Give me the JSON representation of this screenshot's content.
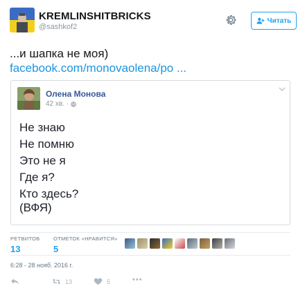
{
  "header": {
    "display_name": "KREMLINSHITBRICKS",
    "handle": "@sashkof2",
    "follow_label": "Читать"
  },
  "tweet": {
    "text": "...и шапка не моя)",
    "link": "facebook.com/monovaolena/po ..."
  },
  "card": {
    "author": "Олена Монова",
    "time": "42 хв. ·",
    "lines": [
      "Не знаю",
      "Не помню",
      "Это не я",
      "Где я?",
      "Кто здесь?"
    ],
    "extra": "(ВФЯ)"
  },
  "stats": {
    "retweets_label": "РЕТВИТОВ",
    "retweets_value": "13",
    "likes_label": "ОТМЕТОК «НРАВИТСЯ»",
    "likes_value": "5"
  },
  "timestamp": "6:28 - 28 нояб. 2016 г.",
  "actions": {
    "retweet_count": "13",
    "like_count": "5"
  },
  "colors": {
    "accent": "#1da1f2",
    "link": "#1b95e0",
    "fb_name": "#365899"
  }
}
